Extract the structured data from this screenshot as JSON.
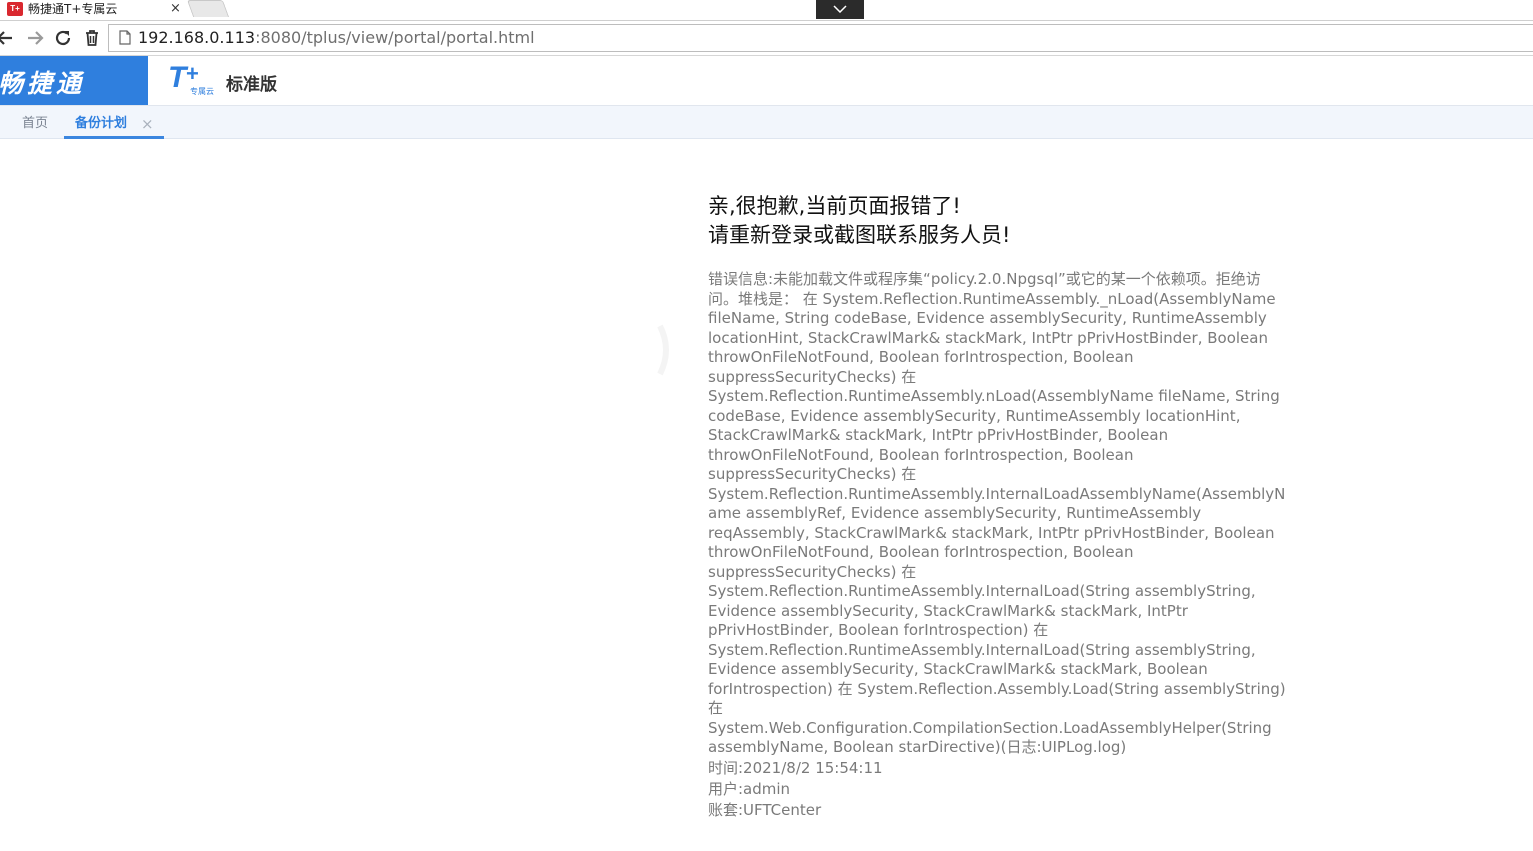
{
  "browser": {
    "tab": {
      "favicon_text": "T+",
      "title": "畅捷通T+专属云",
      "close_glyph": "×"
    },
    "url": {
      "host": "192.168.0.113",
      "rest": ":8080/tplus/view/portal/portal.html"
    }
  },
  "app": {
    "brand": "畅捷通",
    "product_logo_sub": "专属云",
    "product_name": "标准版",
    "colors": {
      "brand_blue": "#2f7fde",
      "tab_active": "#2f7fde"
    }
  },
  "tabs": [
    {
      "label": "首页"
    },
    {
      "label": "备份计划",
      "close_glyph": "×",
      "active": true
    }
  ],
  "error": {
    "line1": "亲,很抱歉,当前页面报错了!",
    "line2": "请重新登录或截图联系服务人员!",
    "message": "错误信息:未能加载文件或程序集“policy.2.0.Npgsql”或它的某一个依赖项。拒绝访问。堆栈是：  在 System.Reflection.RuntimeAssembly._nLoad(AssemblyName fileName, String codeBase, Evidence assemblySecurity, RuntimeAssembly locationHint, StackCrawlMark& stackMark, IntPtr pPrivHostBinder, Boolean throwOnFileNotFound, Boolean forIntrospection, Boolean suppressSecurityChecks) 在 System.Reflection.RuntimeAssembly.nLoad(AssemblyName fileName, String codeBase, Evidence assemblySecurity, RuntimeAssembly locationHint, StackCrawlMark& stackMark, IntPtr pPrivHostBinder, Boolean throwOnFileNotFound, Boolean forIntrospection, Boolean suppressSecurityChecks) 在 System.Reflection.RuntimeAssembly.InternalLoadAssemblyName(AssemblyName assemblyRef, Evidence assemblySecurity, RuntimeAssembly reqAssembly, StackCrawlMark& stackMark, IntPtr pPrivHostBinder, Boolean throwOnFileNotFound, Boolean forIntrospection, Boolean suppressSecurityChecks) 在 System.Reflection.RuntimeAssembly.InternalLoad(String assemblyString, Evidence assemblySecurity, StackCrawlMark& stackMark, IntPtr pPrivHostBinder, Boolean forIntrospection) 在 System.Reflection.RuntimeAssembly.InternalLoad(String assemblyString, Evidence assemblySecurity, StackCrawlMark& stackMark, Boolean forIntrospection) 在 System.Reflection.Assembly.Load(String assemblyString) 在 System.Web.Configuration.CompilationSection.LoadAssemblyHelper(String assemblyName, Boolean starDirective)(日志:UIPLog.log)",
    "time": "时间:2021/8/2 15:54:11",
    "user": "用户:admin",
    "account": "账套:UFTCenter"
  }
}
